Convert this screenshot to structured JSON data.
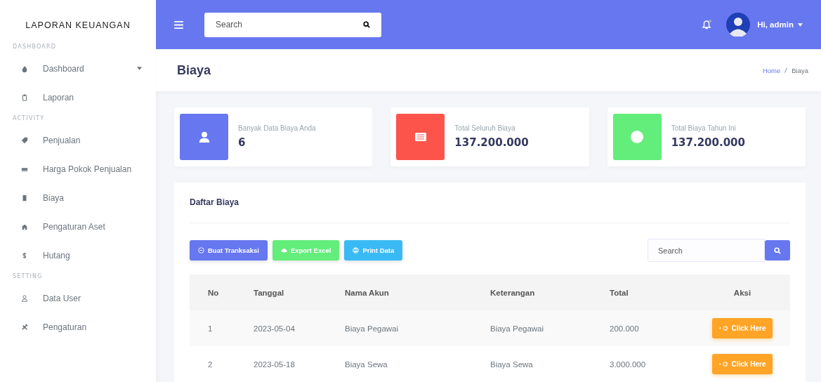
{
  "sidebar": {
    "brand": "LAPORAN KEUANGAN",
    "items": [
      {
        "kind": "header",
        "label": "DASHBOARD"
      },
      {
        "kind": "item",
        "label": "Dashboard",
        "has_caret": true
      },
      {
        "kind": "item",
        "label": "Laporan",
        "has_caret": false
      },
      {
        "kind": "header",
        "label": "ACTIVITY"
      },
      {
        "kind": "item",
        "label": "Penjualan",
        "has_caret": false
      },
      {
        "kind": "item",
        "label": "Harga Pokok Penjualan",
        "has_caret": false
      },
      {
        "kind": "item",
        "label": "Biaya",
        "has_caret": false
      },
      {
        "kind": "item",
        "label": "Pengaturan Aset",
        "has_caret": false
      },
      {
        "kind": "item",
        "label": "Hutang",
        "has_caret": false
      },
      {
        "kind": "header",
        "label": "SETTING"
      },
      {
        "kind": "item",
        "label": "Data User",
        "has_caret": false
      },
      {
        "kind": "item",
        "label": "Pengaturan",
        "has_caret": false
      }
    ]
  },
  "topbar": {
    "search": {
      "placeholder": "Search"
    },
    "notification_dot": true,
    "user": "Hi, admin"
  },
  "page": {
    "title": "Biaya",
    "breadcrumb": [
      {
        "label": "Home",
        "link": true
      },
      {
        "label": "Biaya",
        "link": false
      }
    ]
  },
  "stats": [
    {
      "label": "Banyak Data Biaya Anda",
      "value": "6",
      "color": "#6777ef"
    },
    {
      "label": "Total Seluruh Biaya",
      "value": "137.200.000",
      "color": "#fc544b"
    },
    {
      "label": "Total Biaya Tahun Ini",
      "value": "137.200.000",
      "color": "#63ed7a"
    }
  ],
  "card": {
    "title": "Daftar Biaya",
    "buttons": [
      {
        "label": "Buat Tranksaksi",
        "color": "#6777ef"
      },
      {
        "label": "Export Excel",
        "color": "#63ed7a"
      },
      {
        "label": "Print Data",
        "color": "#3abaf4"
      }
    ],
    "search": {
      "placeholder": "Search"
    },
    "table": {
      "columns": [
        "No",
        "Tanggal",
        "Nama Akun",
        "Keterangan",
        "Total",
        "Aksi"
      ],
      "rows": [
        {
          "no": "1",
          "tanggal": "2023-05-04",
          "nama_akun": "Biaya Pegawai",
          "keterangan": "Biaya Pegawai",
          "total": "200.000",
          "action": "Click Here"
        },
        {
          "no": "2",
          "tanggal": "2023-05-18",
          "nama_akun": "Biaya Sewa",
          "keterangan": "Biaya Sewa",
          "total": "3.000.000",
          "action": "Click Here"
        }
      ]
    }
  }
}
